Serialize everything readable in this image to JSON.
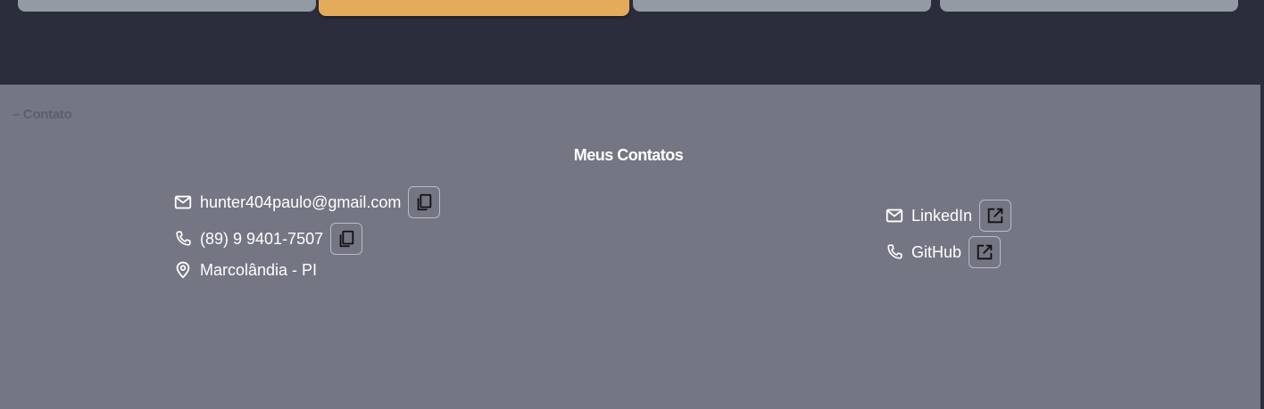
{
  "section": {
    "tag": "– Contato",
    "title": "Meus Contatos"
  },
  "contacts": {
    "email": {
      "icon": "mail-icon",
      "text": "hunter404paulo@gmail.com",
      "action_icon": "copy-icon"
    },
    "phone": {
      "icon": "phone-icon",
      "text": "(89) 9 9401-7507",
      "action_icon": "copy-icon"
    },
    "location": {
      "icon": "location-pin-icon",
      "text": "Marcolândia - PI"
    }
  },
  "links": {
    "linkedin": {
      "icon": "mail-icon",
      "text": "LinkedIn",
      "action_icon": "open-in-new-icon"
    },
    "github": {
      "icon": "phone-icon",
      "text": "GitHub",
      "action_icon": "open-in-new-icon"
    }
  },
  "colors": {
    "top_band": "#2b2d3c",
    "section_bg": "#747684",
    "card_gray": "#939aa3",
    "card_active": "#e3ab5a"
  }
}
